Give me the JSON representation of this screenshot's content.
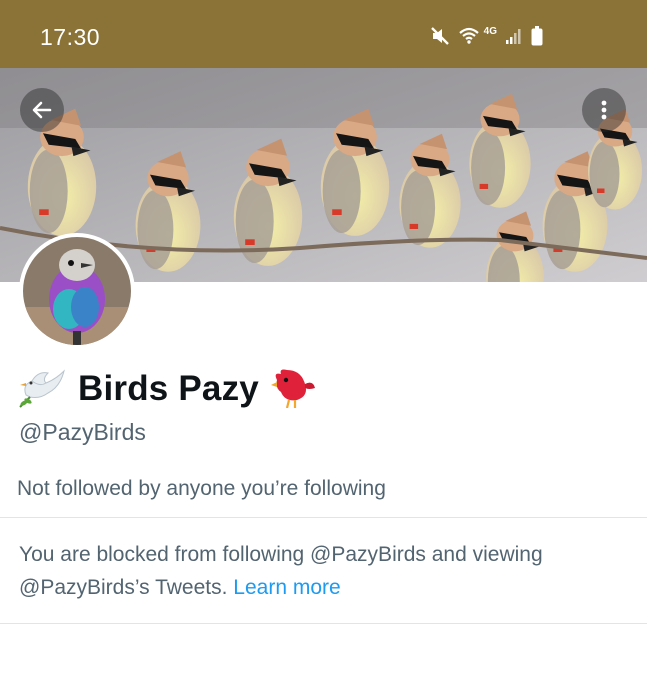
{
  "status_bar": {
    "time": "17:30",
    "network_label": "4G",
    "icons": [
      "mute-icon",
      "wifi-icon",
      "signal-icon",
      "battery-icon"
    ]
  },
  "header": {
    "back_icon": "arrow-left-icon",
    "more_icon": "more-vertical-icon"
  },
  "profile": {
    "display_name": "Birds Pazy",
    "name_prefix_emoji": "dove-icon",
    "name_suffix_emoji": "red-bird-icon",
    "handle": "@PazyBirds",
    "followers_note": "Not followed by anyone you’re following",
    "blocked_notice": "You are blocked from following @PazyBirds and viewing @PazyBirds’s Tweets.",
    "learn_more": "Learn more"
  },
  "colors": {
    "status_bar_bg": "#8b7236",
    "link": "#1d9bf0",
    "secondary_text": "#536471",
    "primary_text": "#0f1419"
  }
}
